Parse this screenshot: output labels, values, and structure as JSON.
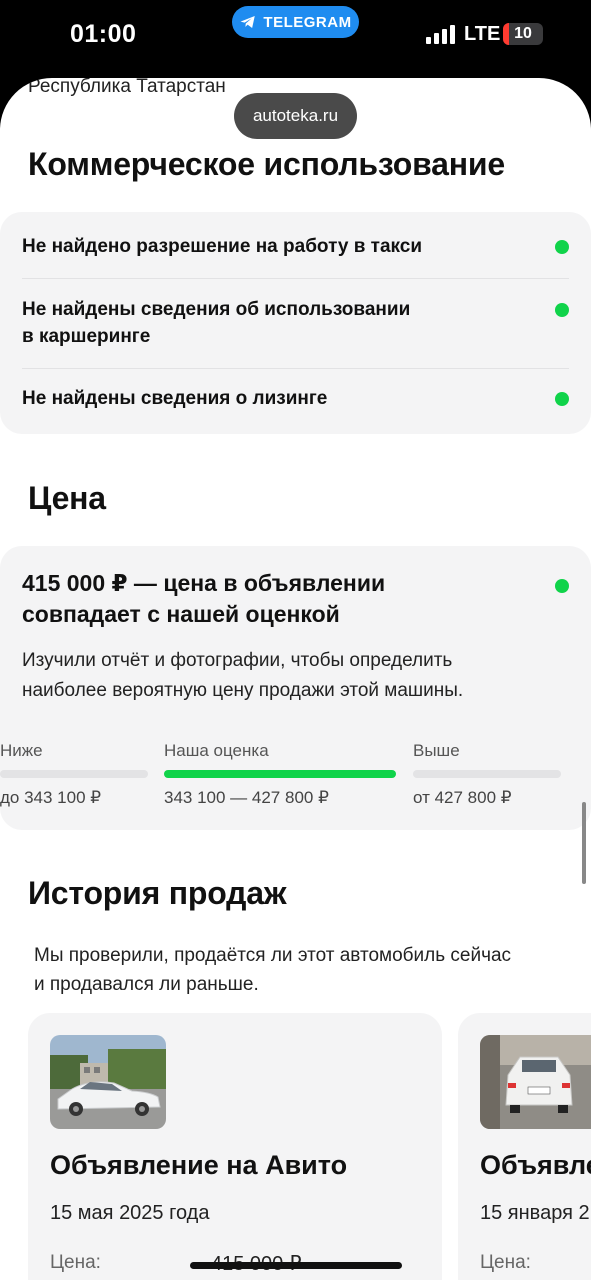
{
  "status_bar": {
    "time": "01:00",
    "app_pill": "TELEGRAM",
    "network": "LTE",
    "battery": "10",
    "battery_color": "#ff3b30"
  },
  "browser": {
    "url": "autoteka.ru"
  },
  "region": "Республика Татарстан",
  "commercial": {
    "title": "Коммерческое использование",
    "items": [
      {
        "text": "Не найдено разрешение на работу в такси",
        "status_color": "#10d34a"
      },
      {
        "line1": "Не найдены сведения об использовании",
        "line2": "в каршеринге",
        "status_color": "#10d34a"
      },
      {
        "text": "Не найдены сведения о лизинге",
        "status_color": "#10d34a"
      }
    ]
  },
  "price": {
    "title": "Цена",
    "headline_line1": "415 000 ₽ — цена в объявлении",
    "headline_line2": "совпадает с нашей оценкой",
    "desc_line1": "Изучили отчёт и фотографии, чтобы определить",
    "desc_line2": "наиболее вероятную цену продажи этой машины.",
    "scale": {
      "below_label": "Ниже",
      "below_value": "до 343 100 ₽",
      "estimate_label": "Наша оценка",
      "estimate_value": "343 100 — 427 800 ₽",
      "above_label": "Выше",
      "above_value": "от 427 800 ₽"
    },
    "accent": "#10d34a"
  },
  "history": {
    "title": "История продаж",
    "desc_line1": "Мы проверили, продаётся ли этот автомобиль сейчас",
    "desc_line2": "и продавался ли раньше.",
    "listings": [
      {
        "title": "Объявление на Авито",
        "date": "15 мая 2025 года",
        "price_label": "Цена:",
        "price": "415 000 ₽"
      },
      {
        "title": "Объявле",
        "date": "15 января 2",
        "price_label": "Цена:"
      }
    ]
  }
}
